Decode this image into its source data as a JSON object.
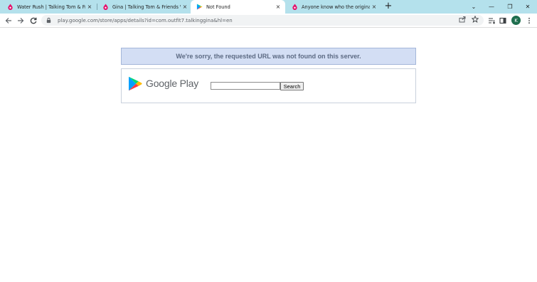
{
  "tabs": [
    {
      "title": "Water Rush | Talking Tom & Friends Wiki",
      "favicon": "fandom-icon",
      "close": "×",
      "active": false
    },
    {
      "title": "Gina | Talking Tom & Friends Wiki",
      "favicon": "fandom-icon",
      "close": "×",
      "active": false
    },
    {
      "title": "Not Found",
      "favicon": "google-play-icon",
      "close": "×",
      "active": true
    },
    {
      "title": "Anyone know who the original voice of Gina is",
      "favicon": "fandom-icon",
      "close": "×",
      "active": false
    }
  ],
  "new_tab": "+",
  "window_controls": {
    "tab_search": "⌄",
    "minimize": "—",
    "restore": "❐",
    "close": "✕"
  },
  "address_bar": {
    "url": "play.google.com/store/apps/details?id=com.outfit7.talkinggina&hl=en"
  },
  "profile": {
    "initial": "K",
    "color": "#1e6e4e"
  },
  "page": {
    "error_message": "We're sorry, the requested URL was not found on this server.",
    "logo_text": "Google Play",
    "search_value": "",
    "search_button": "Search"
  },
  "colors": {
    "tabstrip": "#b4e1ec",
    "error_bg": "#d3def4",
    "error_text": "#5c6a83",
    "fandom": "#e4106b"
  }
}
